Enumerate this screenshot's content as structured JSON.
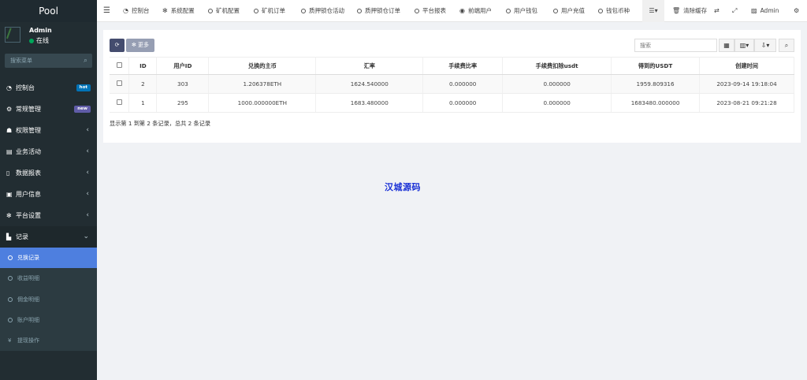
{
  "app": {
    "title": "Pool"
  },
  "user": {
    "name": "Admin",
    "status": "在线"
  },
  "sidebar": {
    "search_placeholder": "搜索菜单",
    "items": [
      {
        "label": "控制台",
        "badge": "hot",
        "badge_color": "#0073b7"
      },
      {
        "label": "常规管理",
        "badge": "new",
        "badge_color": "#605ca8"
      },
      {
        "label": "权限管理"
      },
      {
        "label": "业务活动"
      },
      {
        "label": "数据报表"
      },
      {
        "label": "用户信息"
      },
      {
        "label": "平台设置"
      },
      {
        "label": "记录"
      }
    ],
    "subitems": [
      {
        "label": "兑换记录"
      },
      {
        "label": "收益明细"
      },
      {
        "label": "佣金明细"
      },
      {
        "label": "账户明细"
      },
      {
        "label": "提现操作"
      }
    ]
  },
  "topnav": {
    "items": [
      "控制台",
      "系统配置",
      "矿机配置",
      "矿机订单",
      "质押锁仓活动",
      "质押锁仓订单",
      "平台报表",
      "前端用户",
      "用户钱包",
      "用户充值",
      "钱包币种"
    ],
    "clear_cache": "清除缓存",
    "admin": "Admin"
  },
  "toolbar": {
    "more_label": "更多",
    "search_placeholder": "搜索"
  },
  "table": {
    "headers": [
      "ID",
      "用户ID",
      "兑换的主币",
      "汇率",
      "手续费比率",
      "手续费扣除usdt",
      "得到的USDT",
      "创建时间"
    ],
    "rows": [
      [
        "2",
        "303",
        "1.206378ETH",
        "1624.540000",
        "0.000000",
        "0.000000",
        "1959.809316",
        "2023-09-14 19:18:04"
      ],
      [
        "1",
        "295",
        "1000.000000ETH",
        "1683.480000",
        "0.000000",
        "0.000000",
        "1683480.000000",
        "2023-08-21 09:21:28"
      ]
    ],
    "summary": "显示第 1 到第 2 条记录，总共 2 条记录"
  },
  "watermark": "汉城源码"
}
